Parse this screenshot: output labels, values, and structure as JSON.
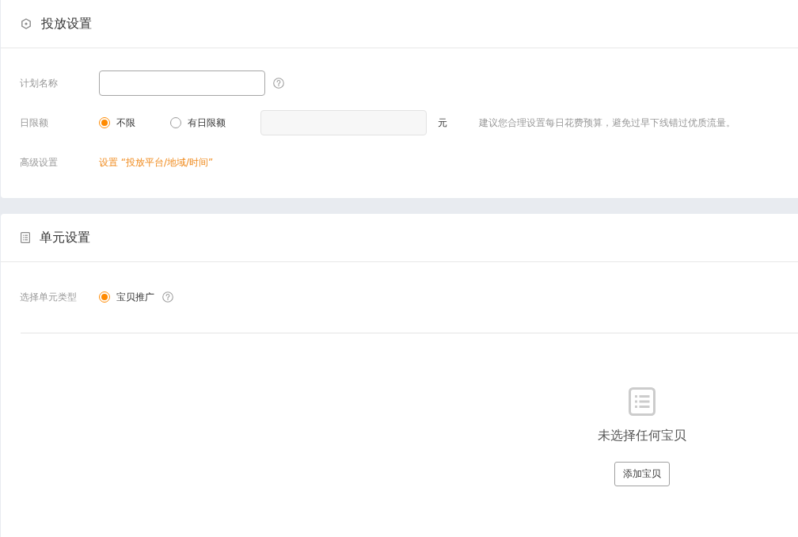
{
  "sections": [
    {
      "title": "投放设置",
      "fields": [
        {
          "kind": "input",
          "label": "计划名称",
          "help": true
        },
        {
          "kind": "radio",
          "label": "日限额",
          "options": [
            {
              "label": "不限",
              "selected": true
            },
            {
              "label": "有日限额",
              "selected": false
            }
          ],
          "amount": {
            "disabled": true,
            "unit": "元"
          },
          "hint": "建议您合理设置每日花费预算，避免过早下线错过优质流量。"
        },
        {
          "kind": "link",
          "label": "高级设置",
          "link": "设置 “投放平台/地域/时间”"
        }
      ]
    },
    {
      "title": "单元设置",
      "fields": [
        {
          "kind": "radio",
          "label": "选择单元类型",
          "options": [
            {
              "label": "宝贝推广",
              "selected": true
            }
          ],
          "help": true
        }
      ],
      "empty_state": {
        "message": "未选择任何宝贝",
        "button": "添加宝贝"
      }
    }
  ]
}
